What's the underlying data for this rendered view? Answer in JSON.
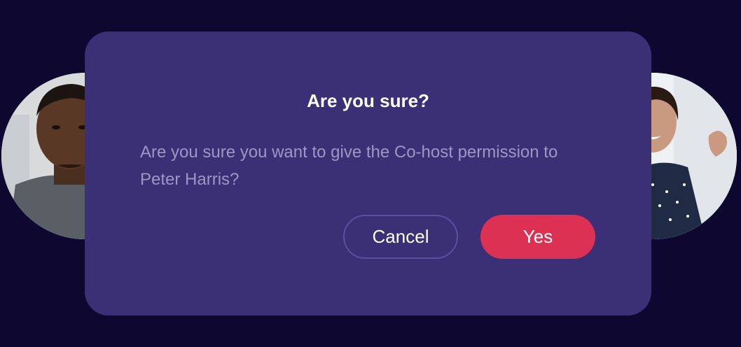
{
  "dialog": {
    "title": "Are you sure?",
    "message": "Are you sure you want to give the Co-host permission to Peter Harris?",
    "buttons": {
      "cancel_label": "Cancel",
      "confirm_label": "Yes"
    }
  },
  "participants": [
    {
      "icon": "participant-video-tile"
    },
    {
      "icon": "participant-video-tile"
    }
  ],
  "colors": {
    "background": "#0e0830",
    "dialog": "#3b2f75",
    "title": "#ffffff",
    "message": "#9e96c4",
    "confirm": "#dc3153",
    "cancel_border": "#5c4ea0"
  }
}
